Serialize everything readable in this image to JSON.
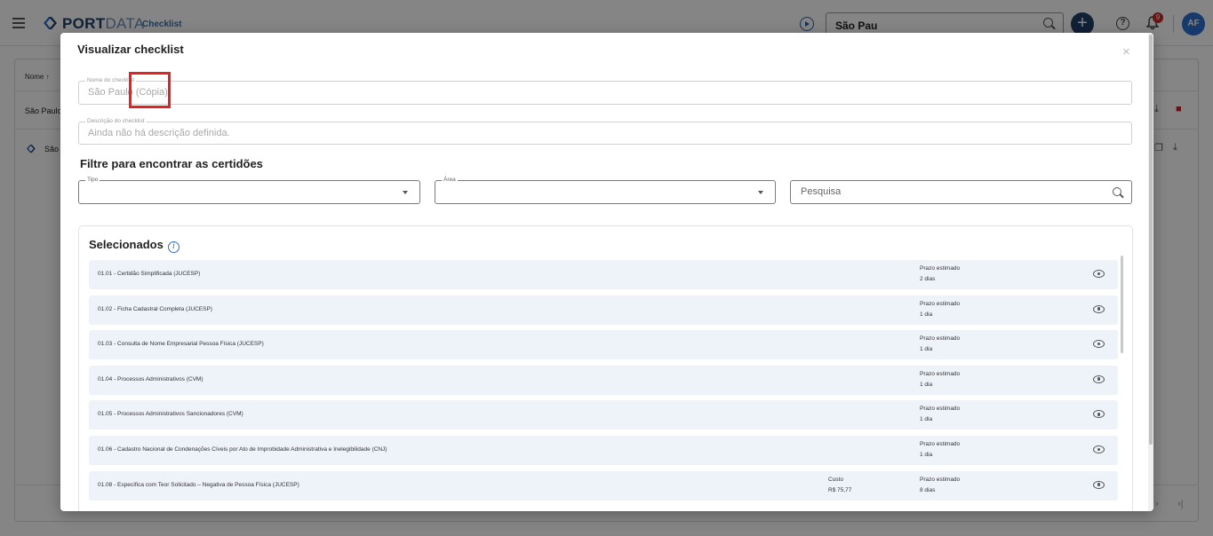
{
  "app": {
    "brand_bold": "PORT",
    "brand_light": "DATA",
    "section": "Checklist",
    "search_value": "São Pau",
    "notification_count": "9",
    "avatar_initials": "AF",
    "add_label": "+",
    "help_label": "?"
  },
  "background": {
    "column_header": "Nome ↑",
    "row1_name": "São Paulo",
    "row2_name": "São"
  },
  "modal": {
    "title": "Visualizar checklist",
    "close_label": "×",
    "name_field": {
      "legend": "Nome do checklist",
      "value": "São Paulo (Cópia)"
    },
    "description_field": {
      "legend": "Descrição do checklist",
      "value": "Ainda não há descrição definida."
    },
    "filter_heading": "Filtre para encontrar as certidões",
    "tipo_field": {
      "legend": "Tipo",
      "value": ""
    },
    "area_field": {
      "legend": "Área",
      "value": ""
    },
    "search_field": {
      "placeholder": "Pesquisa"
    },
    "selected_title": "Selecionados",
    "info_label": "i",
    "items": [
      {
        "name": "01.01 - Certidão Simplificada (JUCESP)",
        "cost_label": "",
        "cost_value": "",
        "prazo_label": "Prazo estimado",
        "prazo_value": "2 dias"
      },
      {
        "name": "01.02 - Ficha Cadastral Completa (JUCESP)",
        "cost_label": "",
        "cost_value": "",
        "prazo_label": "Prazo estimado",
        "prazo_value": "1 dia"
      },
      {
        "name": "01.03 - Consulta de Nome Empresarial Pessoa Física (JUCESP)",
        "cost_label": "",
        "cost_value": "",
        "prazo_label": "Prazo estimado",
        "prazo_value": "1 dia"
      },
      {
        "name": "01.04 - Processos Administrativos (CVM)",
        "cost_label": "",
        "cost_value": "",
        "prazo_label": "Prazo estimado",
        "prazo_value": "1 dia"
      },
      {
        "name": "01.05 - Processos Administrativos Sancionadores (CVM)",
        "cost_label": "",
        "cost_value": "",
        "prazo_label": "Prazo estimado",
        "prazo_value": "1 dia"
      },
      {
        "name": "01.06 - Cadastro Nacional de Condenações Cíveis por Ato de Improbidade Administrativa e Inelegibilidade (CNJ)",
        "cost_label": "",
        "cost_value": "",
        "prazo_label": "Prazo estimado",
        "prazo_value": "1 dia"
      },
      {
        "name": "01.08 - Específica com Teor Solicitado – Negativa de Pessoa Física (JUCESP)",
        "cost_label": "Custo",
        "cost_value": "R$ 75,77",
        "prazo_label": "Prazo estimado",
        "prazo_value": "8 dias"
      }
    ]
  },
  "colors": {
    "brand": "#1f3f68",
    "accent": "#2b6fd0",
    "item_bg": "#eef2f9",
    "highlight": "#e32222",
    "danger": "#c62828"
  }
}
